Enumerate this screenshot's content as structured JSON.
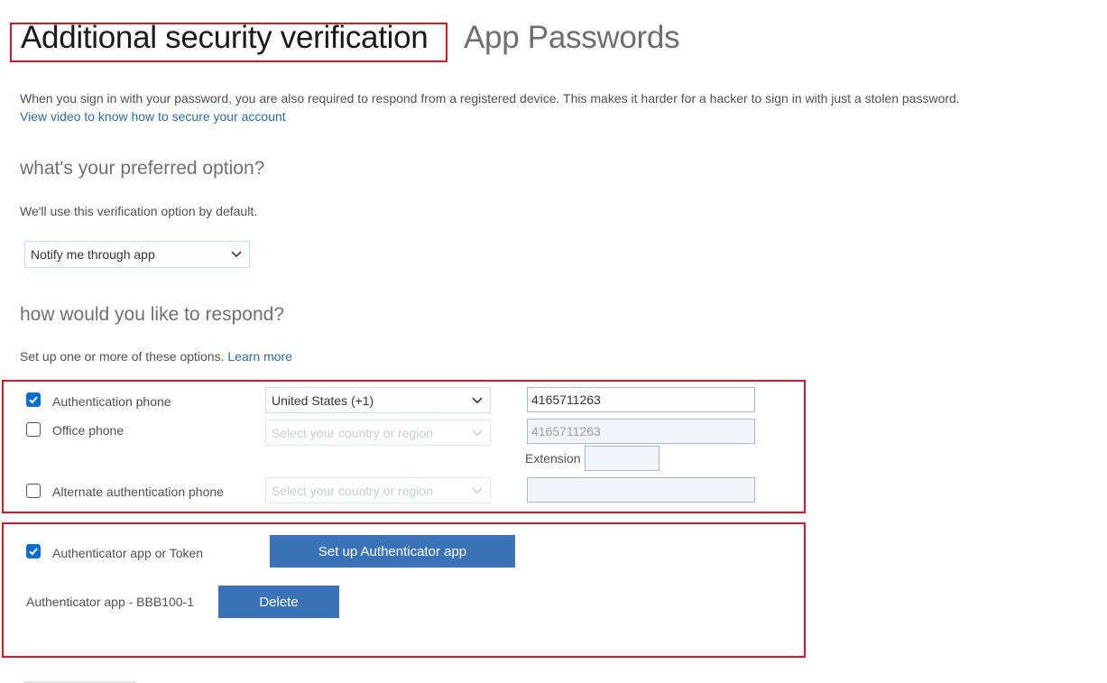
{
  "header": {
    "title": "Additional security verification",
    "tab_app_passwords": "App Passwords"
  },
  "intro": {
    "text": "When you sign in with your password, you are also required to respond from a registered device. This makes it harder for a hacker to sign in with just a stolen password.",
    "video_link": "View video to know how to secure your account"
  },
  "preferred": {
    "heading": "what's your preferred option?",
    "description": "We'll use this verification option by default.",
    "selected": "Notify me through app"
  },
  "respond": {
    "heading": "how would you like to respond?",
    "description": "Set up one or more of these options.",
    "learn_more": "Learn more"
  },
  "phones": [
    {
      "label": "Authentication phone",
      "checked": true,
      "country": "United States (+1)",
      "number": "4165711263",
      "disabled": false
    },
    {
      "label": "Office phone",
      "checked": false,
      "country": "Select your country or region",
      "number": "4165711263",
      "extension_label": "Extension",
      "extension": "",
      "disabled": true
    },
    {
      "label": "Alternate authentication phone",
      "checked": false,
      "country": "Select your country or region",
      "number": "",
      "disabled": true
    }
  ],
  "authenticator": {
    "label": "Authenticator app or Token",
    "checked": true,
    "setup_button": "Set up Authenticator app",
    "device_label": "Authenticator app - BBB100-1",
    "delete_button": "Delete"
  },
  "colors": {
    "highlight_box": "#e81123",
    "primary_button": "#3b73b9",
    "link": "#2b6ba8",
    "checkbox_checked": "#0a6ed1"
  }
}
